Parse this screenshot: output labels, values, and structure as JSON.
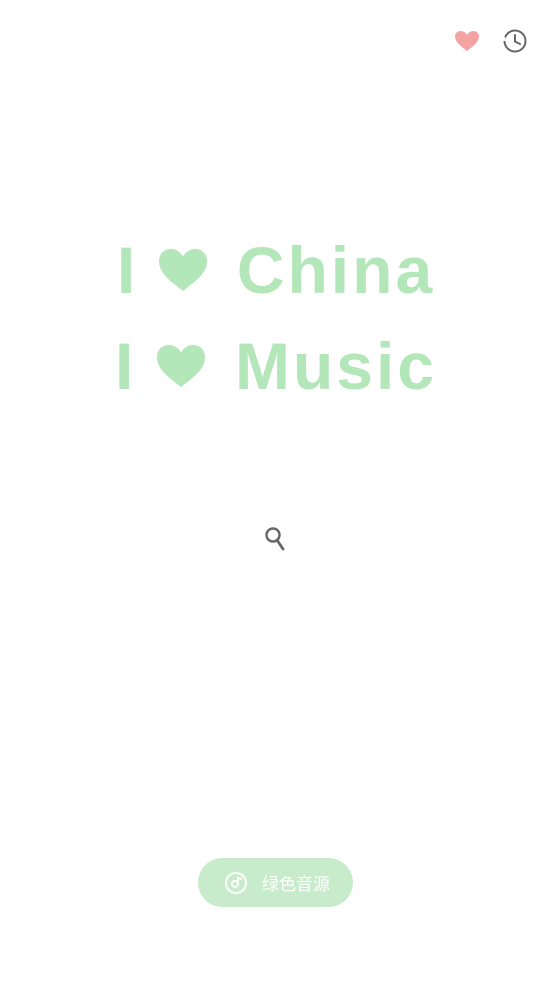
{
  "header": {
    "favorite_icon": "heart-icon",
    "history_icon": "clock-icon"
  },
  "hero": {
    "line1": {
      "pronoun": "I",
      "icon": "heart-icon",
      "word": "China"
    },
    "line2": {
      "pronoun": "I",
      "icon": "heart-icon",
      "word": "Music"
    }
  },
  "search": {
    "icon": "search-icon"
  },
  "source_button": {
    "icon": "disc-icon",
    "label": "绿色音源"
  },
  "colors": {
    "accent_green": "#b3e6b9",
    "pill_green": "#c8eccb",
    "favorite_pink": "#f4a3a3",
    "icon_gray": "#666666"
  }
}
